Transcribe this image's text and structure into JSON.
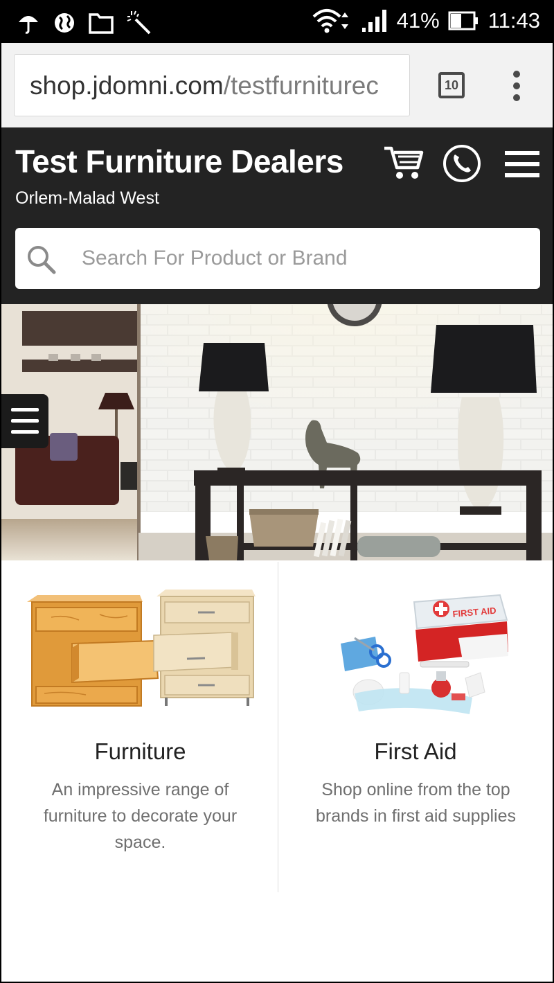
{
  "status_bar": {
    "battery": "41%",
    "time": "11:43",
    "icons": [
      "umbrella-icon",
      "globe-icon",
      "folder-icon",
      "magic-wand-icon",
      "wifi-icon",
      "signal-icon",
      "battery-icon"
    ]
  },
  "browser": {
    "url_host": "shop.jdomni.com",
    "url_path": "/testfurniturec",
    "tab_count": "10"
  },
  "header": {
    "title": "Test Furniture Dealers",
    "subtitle": "Orlem-Malad West",
    "icons": [
      "cart-icon",
      "phone-icon",
      "hamburger-menu-icon"
    ]
  },
  "search": {
    "placeholder": "Search For Product or Brand"
  },
  "categories": [
    {
      "title": "Furniture",
      "description": "An impressive range of furniture to decorate your space."
    },
    {
      "title": "First Aid",
      "description": "Shop online from the top brands in first aid supplies"
    }
  ],
  "images": {
    "first_aid_box_text": "FIRST AID"
  },
  "colors": {
    "header_bg": "#232323",
    "status_bg": "#000000",
    "browser_bg": "#f2f2f2"
  }
}
